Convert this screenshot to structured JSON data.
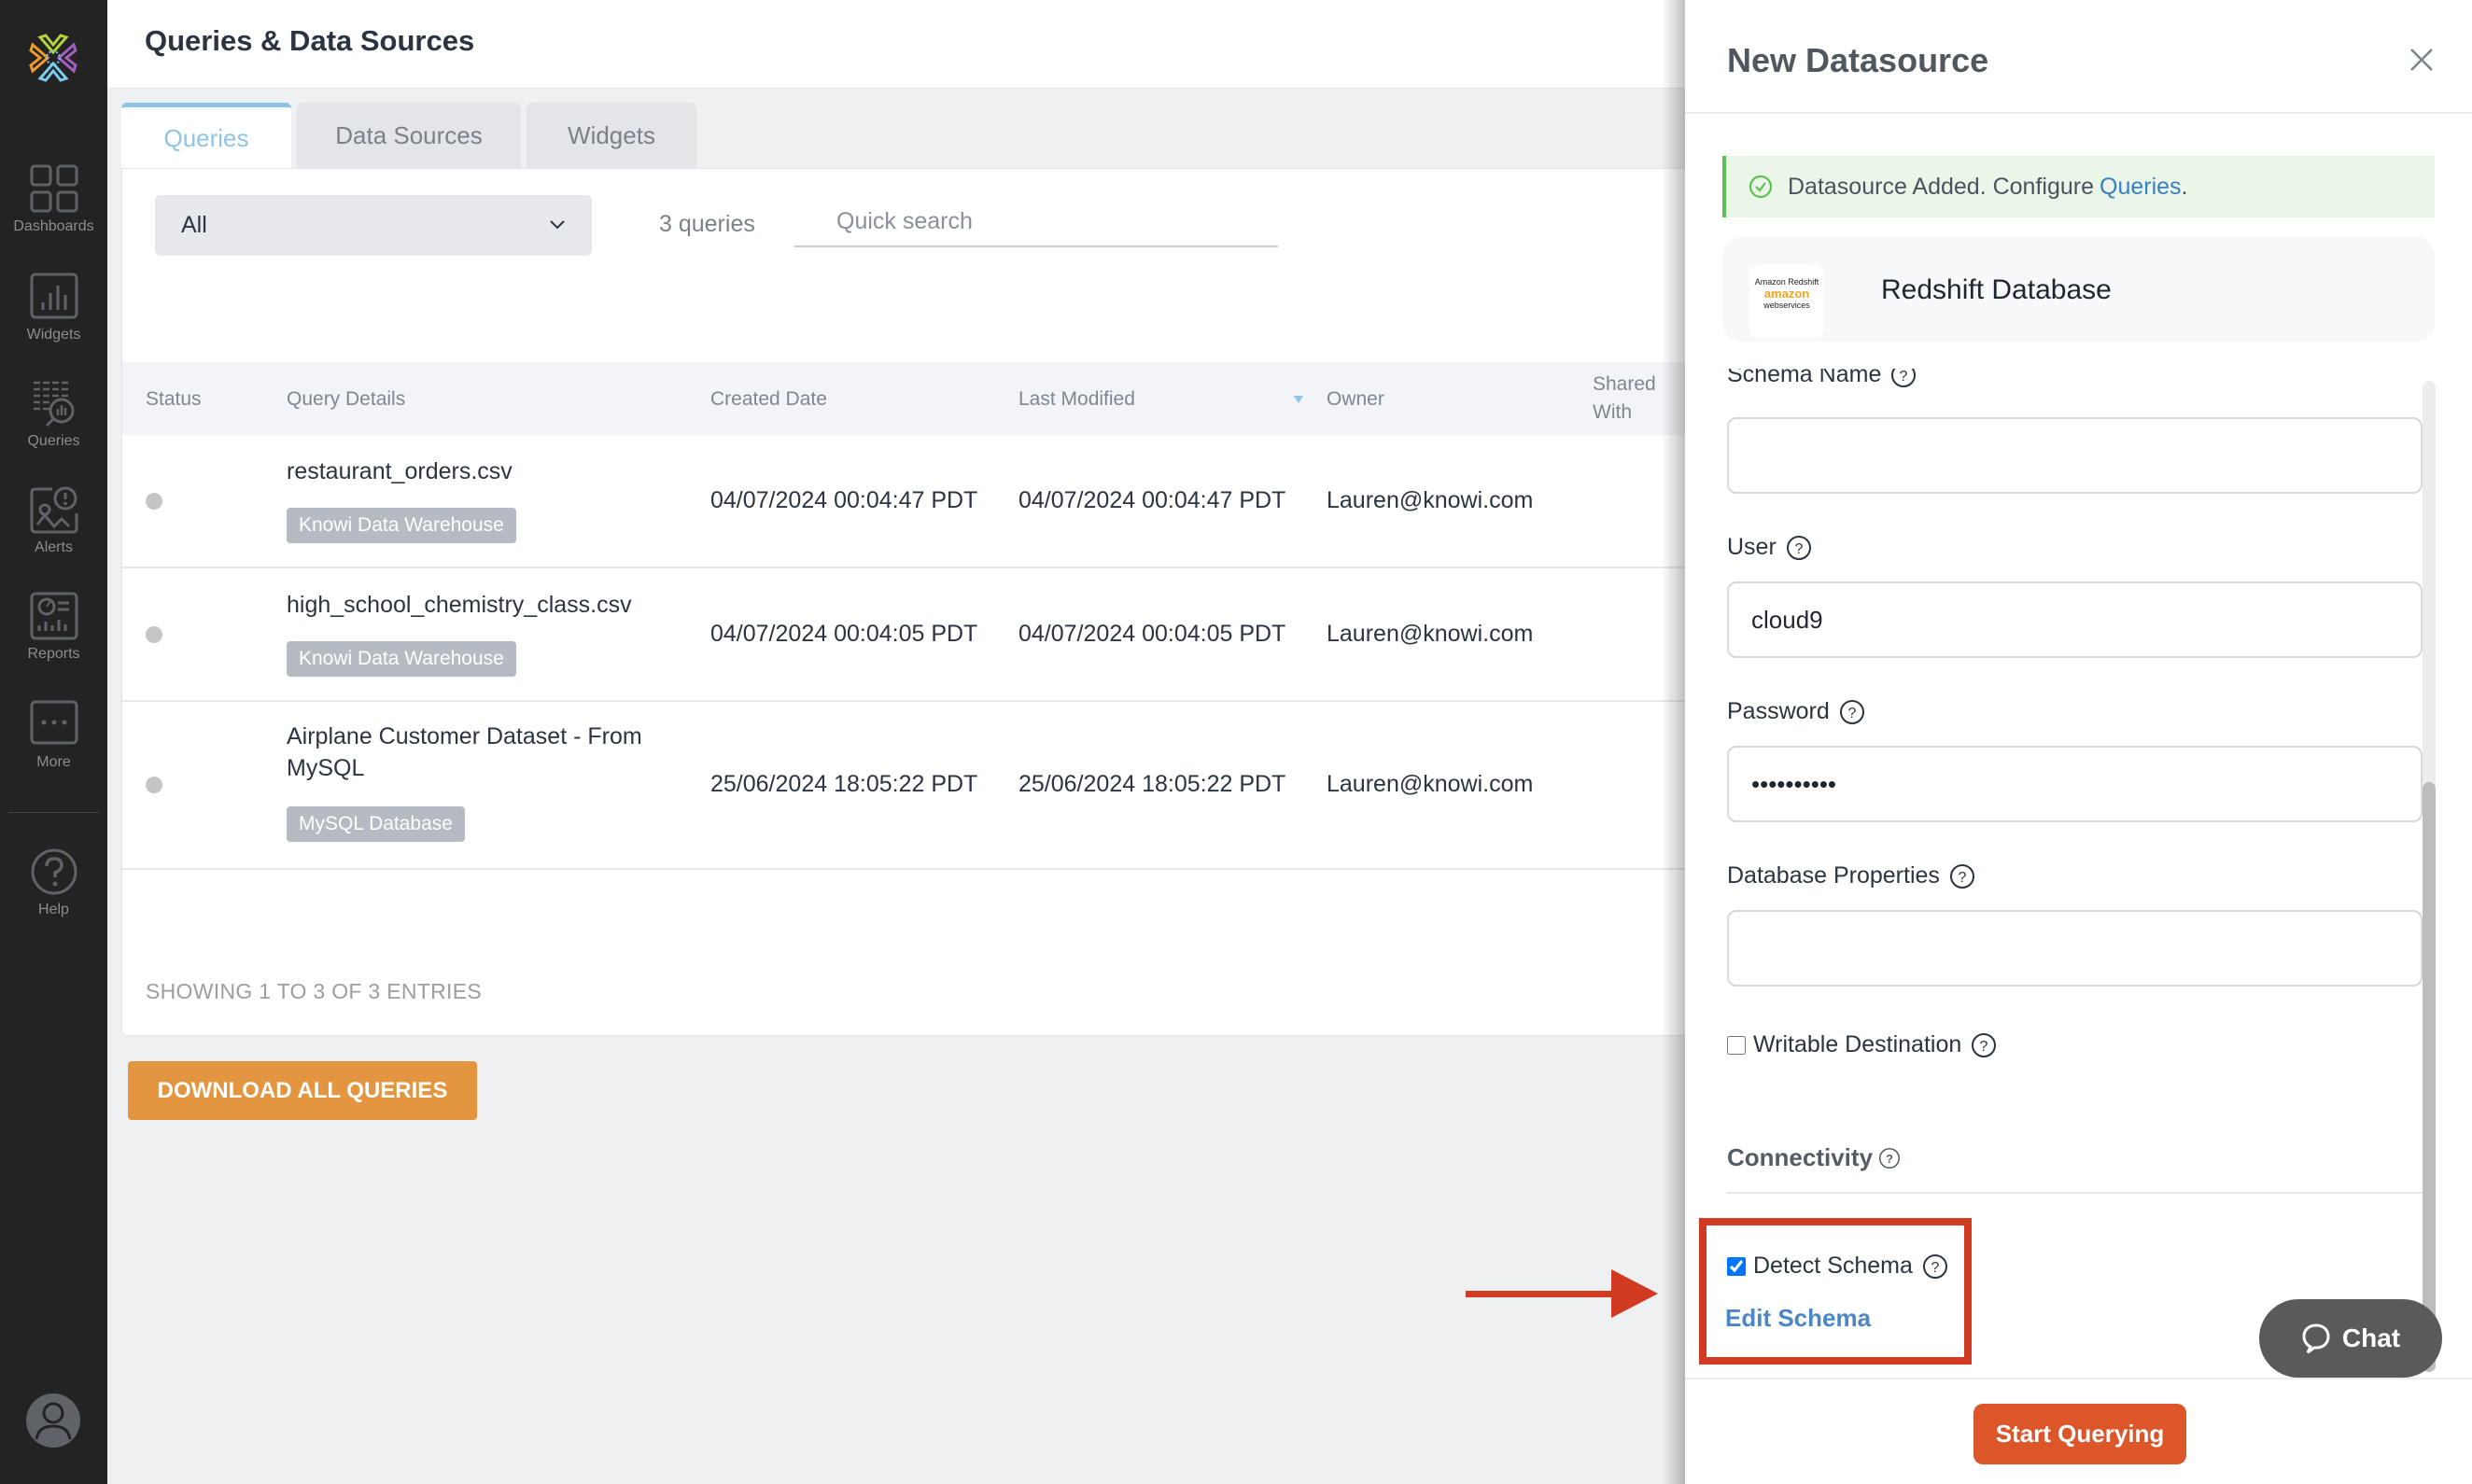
{
  "sidebar": {
    "items": [
      {
        "label": "Dashboards",
        "icon": "dashboards-icon"
      },
      {
        "label": "Widgets",
        "icon": "widgets-icon"
      },
      {
        "label": "Queries",
        "icon": "queries-icon"
      },
      {
        "label": "Alerts",
        "icon": "alerts-icon"
      },
      {
        "label": "Reports",
        "icon": "reports-icon"
      },
      {
        "label": "More",
        "icon": "more-icon"
      },
      {
        "label": "Help",
        "icon": "help-icon"
      }
    ]
  },
  "header": {
    "title": "Queries & Data Sources"
  },
  "tabs": [
    {
      "label": "Queries",
      "active": true
    },
    {
      "label": "Data Sources",
      "active": false
    },
    {
      "label": "Widgets",
      "active": false
    }
  ],
  "filters": {
    "select_value": "All",
    "query_count": "3 queries",
    "search_placeholder": "Quick search"
  },
  "table": {
    "columns": [
      "Status",
      "Query Details",
      "Created Date",
      "Last Modified",
      "Owner",
      "Shared",
      "With"
    ],
    "rows": [
      {
        "name": "restaurant_orders.csv",
        "source": "Knowi Data Warehouse",
        "created": "04/07/2024 00:04:47 PDT",
        "modified": "04/07/2024 00:04:47 PDT",
        "owner": "Lauren@knowi.com"
      },
      {
        "name": "high_school_chemistry_class.csv",
        "source": "Knowi Data Warehouse",
        "created": "04/07/2024 00:04:05 PDT",
        "modified": "04/07/2024 00:04:05 PDT",
        "owner": "Lauren@knowi.com"
      },
      {
        "name": "Airplane Customer Dataset - From MySQL",
        "source": "MySQL Database",
        "created": "25/06/2024 18:05:22 PDT",
        "modified": "25/06/2024 18:05:22 PDT",
        "owner": "Lauren@knowi.com"
      }
    ],
    "entries_text": "SHOWING 1 TO 3 OF 3 ENTRIES"
  },
  "download_button": "DOWNLOAD ALL QUERIES",
  "panel": {
    "title": "New Datasource",
    "alert_text": "Datasource Added. Configure",
    "alert_link": "Queries",
    "alert_suffix": ".",
    "datasource_name": "Redshift Database",
    "logo_line1": "Amazon Redshift",
    "logo_line2": "amazon",
    "logo_line3": "webservices",
    "fields": {
      "schema_label": "Schema Name",
      "schema_value": "",
      "user_label": "User",
      "user_value": "cloud9",
      "password_label": "Password",
      "password_value": "••••••••••",
      "db_props_label": "Database Properties",
      "db_props_value": "",
      "writable_label": "Writable Destination",
      "writable_checked": false,
      "connectivity_label": "Connectivity",
      "detect_schema_label": "Detect Schema",
      "detect_schema_checked": true,
      "edit_schema_link": "Edit Schema"
    },
    "start_button": "Start Querying",
    "chat_button": "Chat"
  },
  "colors": {
    "accent": "#8ec4e6",
    "download": "#e3963f",
    "start": "#dc562a",
    "annotation": "#d03b22",
    "link": "#3b7fc1",
    "success": "#5cbf52"
  }
}
